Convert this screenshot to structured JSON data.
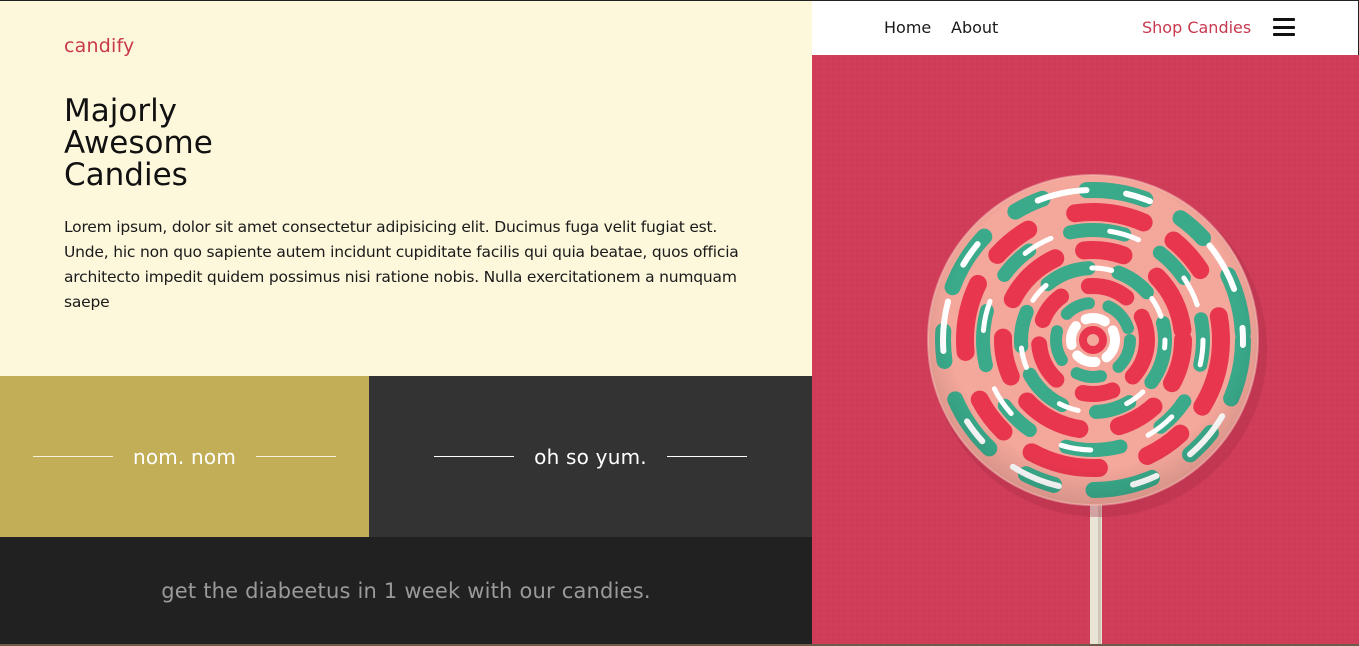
{
  "brand": "candify",
  "nav": {
    "home": "Home",
    "about": "About",
    "shop": "Shop Candies",
    "menu_icon": "hamburger-menu-icon"
  },
  "hero": {
    "headline_lines": [
      "Majorly",
      "Awesome",
      "Candies"
    ],
    "body": "Lorem ipsum, dolor sit amet consectetur adipisicing elit. Ducimus fuga velit fugiat est. Unde, hic non quo sapiente autem incidunt cupiditate facilis qui quia beatae, quos officia architecto impedit quidem possimus nisi ratione nobis. Nulla exercitationem a numquam saepe"
  },
  "tiles": [
    {
      "label": "nom. nom"
    },
    {
      "label": "oh so yum."
    }
  ],
  "tagline": "get the diabeetus in 1 week with our candies.",
  "colors": {
    "brand": "#c8384e",
    "hero_bg": "#fdf8dc",
    "gold": "#c2ae56",
    "dark": "#333334",
    "footer": "#212121",
    "photo_bg": "#d03e5a"
  }
}
